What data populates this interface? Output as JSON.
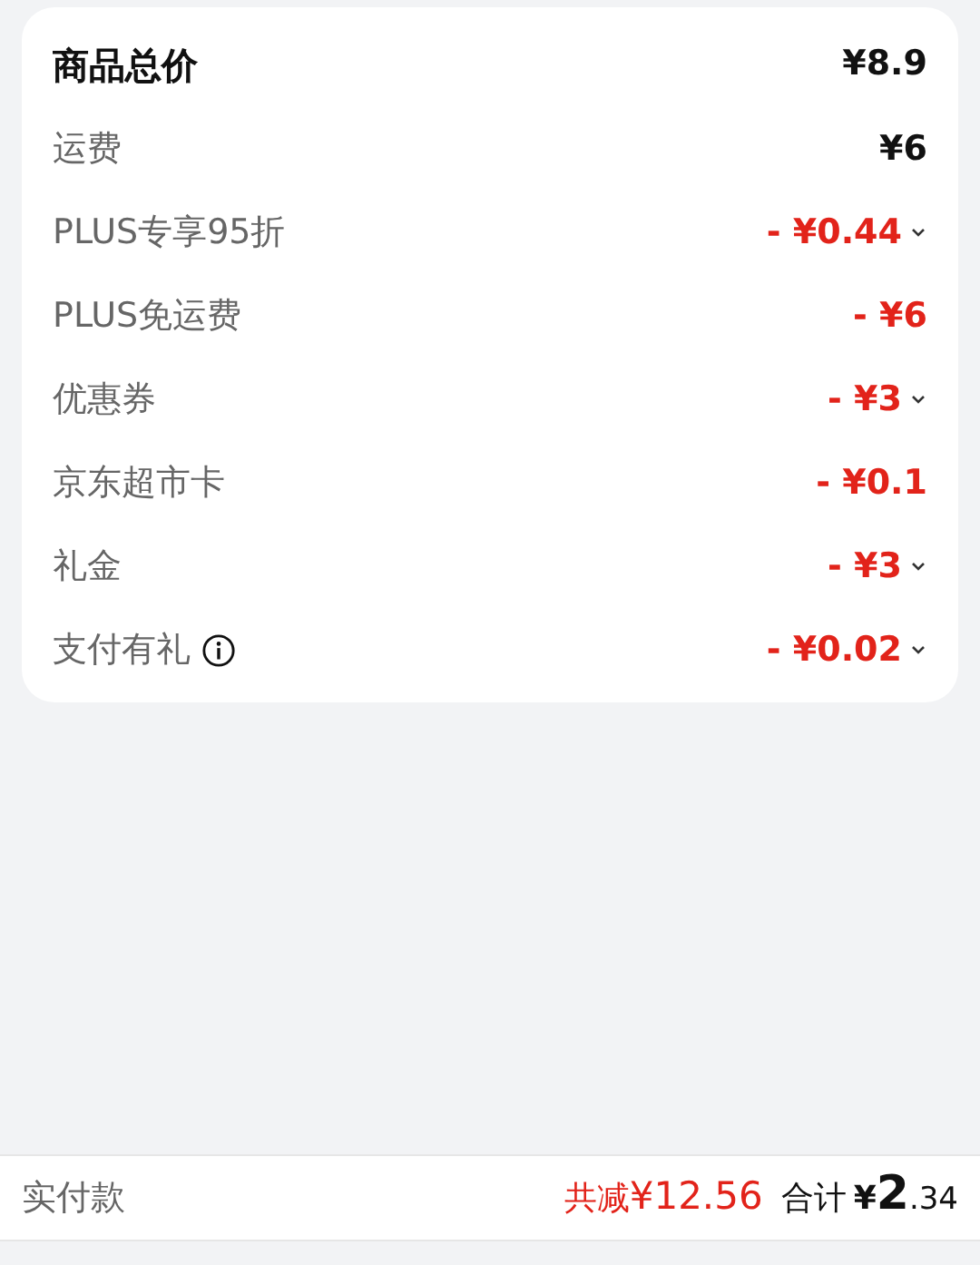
{
  "price_rows": [
    {
      "kind": "total",
      "label": "商品总价",
      "value": "¥8.9",
      "expandable": false,
      "info": false
    },
    {
      "kind": "charge",
      "label": "运费",
      "value": "¥6",
      "expandable": false,
      "info": false
    },
    {
      "kind": "discount",
      "label": "PLUS专享95折",
      "value": "- ¥0.44",
      "expandable": true,
      "info": false
    },
    {
      "kind": "discount",
      "label": "PLUS免运费",
      "value": "- ¥6",
      "expandable": false,
      "info": false
    },
    {
      "kind": "discount",
      "label": "优惠券",
      "value": "- ¥3",
      "expandable": true,
      "info": false
    },
    {
      "kind": "discount",
      "label": "京东超市卡",
      "value": "- ¥0.1",
      "expandable": false,
      "info": false
    },
    {
      "kind": "discount",
      "label": "礼金",
      "value": "- ¥3",
      "expandable": true,
      "info": false
    },
    {
      "kind": "discount",
      "label": "支付有礼",
      "value": "- ¥0.02",
      "expandable": true,
      "info": true
    }
  ],
  "footer": {
    "label": "实付款",
    "discount_label": "共减",
    "discount_amount": "¥12.56",
    "total_label": "合计",
    "total_currency": "¥",
    "total_integer": "2",
    "total_decimal": ".34"
  }
}
